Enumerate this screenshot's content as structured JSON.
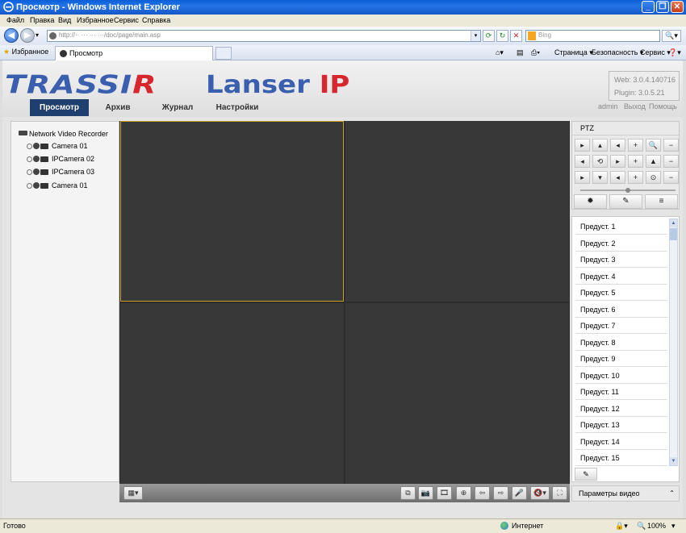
{
  "window": {
    "title": "Просмотр - Windows Internet Explorer",
    "minimize_glyph": "_",
    "maximize_glyph": "❐",
    "close_glyph": "✕"
  },
  "menu": [
    "Файл",
    "Правка",
    "Вид",
    "Избранное",
    "Сервис",
    "Справка"
  ],
  "address": {
    "url": "http://·· ··· ··· ···/doc/page/main.asp",
    "search_placeholder": "Bing",
    "dropdown_glyph": "▾",
    "refresh_glyph": "⟳",
    "go_glyph": "↻",
    "stop_glyph": "✕",
    "search_go_glyph": "🔍▾"
  },
  "favorites": {
    "label": "Избранное",
    "tab_label": "Просмотр",
    "commands": [
      "Страница ▾",
      "Безопасность ▾",
      "Сервис ▾",
      "❓▾"
    ],
    "home_glyph": "⌂▾",
    "rss_glyph": "▤",
    "print_glyph": "⎙▾"
  },
  "app": {
    "logo_trassir_main": "TRASSI",
    "logo_trassir_r": "R",
    "logo_lanser": "Lanser ",
    "logo_ip": "IP",
    "nav": [
      "Просмотр",
      "Архив",
      "Журнал",
      "Настройки"
    ],
    "version_web": "Web: 3.0.4.140716",
    "version_plugin": "Plugin: 3.0.5.21",
    "user_links": [
      "admin",
      "Выход",
      "Помощь"
    ]
  },
  "tree": {
    "root": "Network Video Recorder",
    "cameras": [
      "Camera 01",
      "IPCamera 02",
      "IPCamera 03",
      "Camera 01"
    ]
  },
  "toolbar": {
    "layout_glyph": "▦▾",
    "buttons": [
      "⧉",
      "📷",
      "🎞",
      "⊕",
      "⇦",
      "⇨",
      "🎤",
      "🔇▾",
      "⛶"
    ]
  },
  "ptz": {
    "title": "PTZ",
    "buttons": [
      "▸",
      "▴",
      "◂",
      "+",
      "🔍",
      "−",
      "◂",
      "⟲",
      "▸",
      "+",
      "▲",
      "−",
      "▸",
      "▾",
      "◂",
      "+",
      "⊙",
      "−"
    ],
    "slider_level": 0.5,
    "function_buttons": [
      "✹",
      "✎",
      "≡"
    ]
  },
  "presets": {
    "items": [
      "Предуст. 1",
      "Предуст. 2",
      "Предуст. 3",
      "Предуст. 4",
      "Предуст. 5",
      "Предуст. 6",
      "Предуст. 7",
      "Предуст. 8",
      "Предуст. 9",
      "Предуст. 10",
      "Предуст. 11",
      "Предуст. 12",
      "Предуст. 13",
      "Предуст. 14",
      "Предуст. 15"
    ],
    "tool_glyph": "✎",
    "scroll_up": "▲",
    "scroll_down": "▼"
  },
  "video_params": {
    "label": "Параметры видео",
    "chevron": "⌃"
  },
  "status": {
    "text": "Готово",
    "zone": "Интернет",
    "zoom": "100%",
    "zoom_glyph": "🔍",
    "lock_glyph": "🔒▾",
    "zoom_dd": "▾"
  },
  "colors": {
    "nav_active": "#1f3f6e",
    "logo_blue": "#3a5fae",
    "logo_red": "#d8262e",
    "selected_pane": "#c8a21e"
  }
}
